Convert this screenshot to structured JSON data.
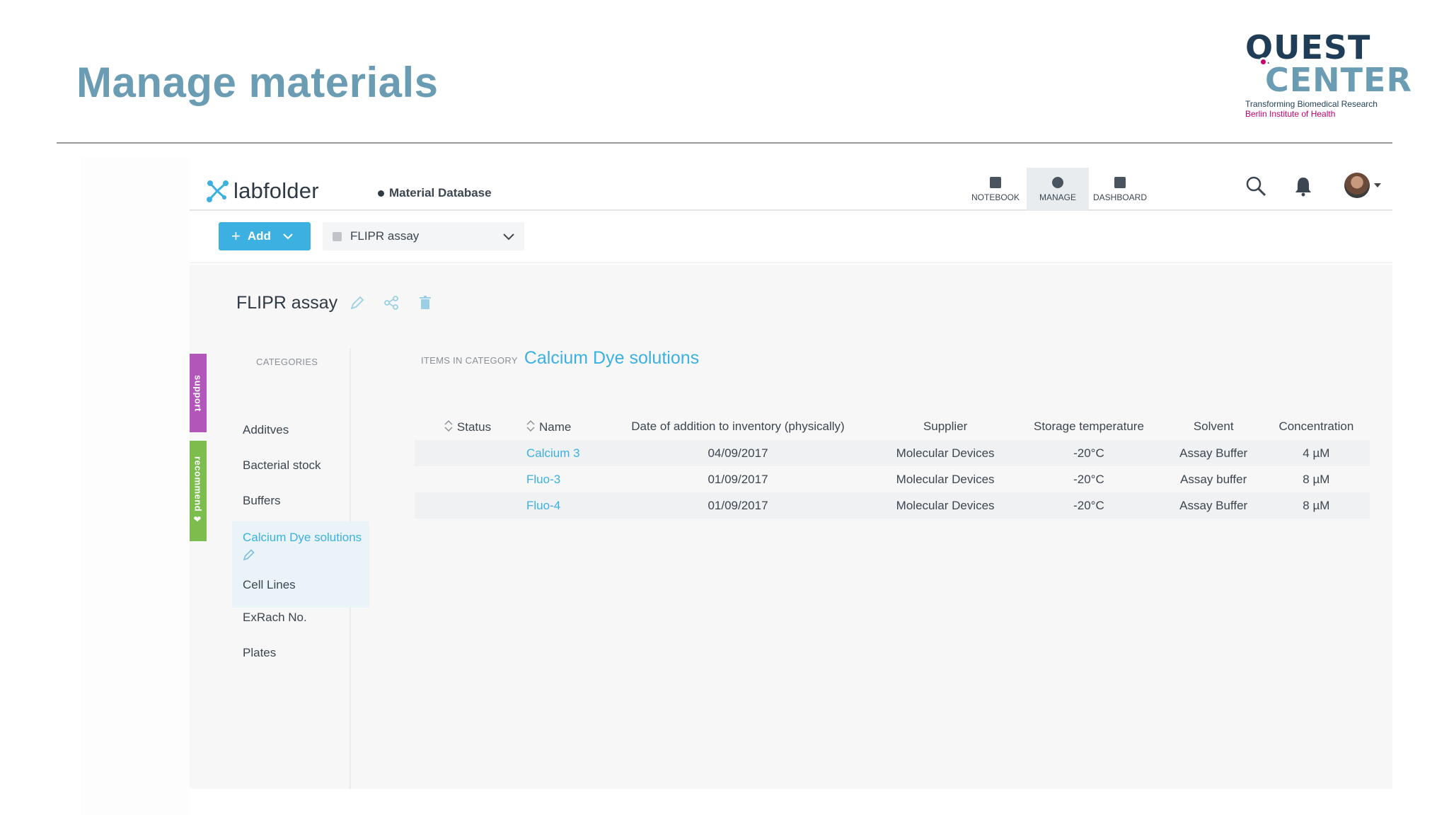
{
  "slide": {
    "title": "Manage materials",
    "logo": {
      "line1": "QUEST",
      "line2": "CENTER",
      "tagline1": "Transforming Biomedical Research",
      "tagline2": "Berlin Institute of Health"
    }
  },
  "app": {
    "brand": "labfolder",
    "breadcrumb": "Material Database",
    "nav": [
      {
        "label": "NOTEBOOK",
        "icon": "notebook-icon"
      },
      {
        "label": "MANAGE",
        "icon": "manage-icon",
        "active": true
      },
      {
        "label": "DASHBOARD",
        "icon": "dashboard-icon"
      }
    ],
    "toolbar": {
      "add_label": "Add",
      "selected_assay": "FLIPR assay"
    },
    "assay": {
      "title": "FLIPR assay"
    },
    "side_tabs": {
      "support": "support",
      "recommend": "recommend ❤"
    },
    "categories": {
      "heading": "CATEGORIES",
      "items": [
        "Additves",
        "Bacterial stock",
        "Buffers",
        "Calcium Dye solutions",
        "Cell Lines",
        "ExRach No.",
        "Plates"
      ],
      "active": "Calcium Dye solutions"
    },
    "items_panel": {
      "label": "ITEMS IN CATEGORY",
      "category": "Calcium Dye solutions",
      "columns": [
        "Status",
        "Name",
        "Date of addition to inventory (physically)",
        "Supplier",
        "Storage temperature",
        "Solvent",
        "Concentration"
      ],
      "rows": [
        {
          "status": "",
          "name": "Calcium 3",
          "date": "04/09/2017",
          "supplier": "Molecular Devices",
          "temp": "-20°C",
          "solvent": "Assay Buffer",
          "conc": "4 µM"
        },
        {
          "status": "",
          "name": "Fluo-3",
          "date": "01/09/2017",
          "supplier": "Molecular Devices",
          "temp": "-20°C",
          "solvent": "Assay buffer",
          "conc": "8 µM"
        },
        {
          "status": "",
          "name": "Fluo-4",
          "date": "01/09/2017",
          "supplier": "Molecular Devices",
          "temp": "-20°C",
          "solvent": "Assay Buffer",
          "conc": "8 µM"
        }
      ]
    },
    "colors": {
      "accent": "#3cb0e1",
      "title": "#6a9db3",
      "support_tab": "#b356b9",
      "recommend_tab": "#7cbd4e"
    }
  }
}
